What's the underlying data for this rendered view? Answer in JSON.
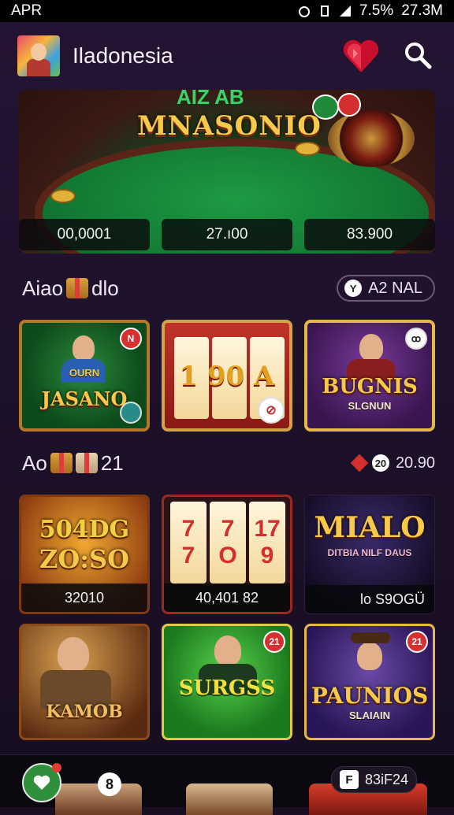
{
  "status_bar": {
    "carrier": "APR",
    "battery": "7.5%",
    "time": "27.3M"
  },
  "header": {
    "app_title": "Iladonesia"
  },
  "hero": {
    "title_top": "AIZ AB",
    "title_main": "MNASONIO",
    "stats": [
      "00,0001",
      "27.ı00",
      "83.900"
    ]
  },
  "section1": {
    "title_left": "Aiao",
    "title_right": "dlo",
    "pill_icon": "Y",
    "pill_label": "A2 NAL"
  },
  "games_row1": [
    {
      "title": "JASANO",
      "top": "OURN",
      "badge": "N"
    },
    {
      "title": "1 90 A",
      "badge": "⊘"
    },
    {
      "title": "BUGNIS",
      "sub": "SLGNUN",
      "badge": "ꝏ"
    }
  ],
  "section2": {
    "title_left": "Ao",
    "title_right": "21",
    "right_icon": "20",
    "right_label": "20.90"
  },
  "games_row2": [
    {
      "title_top": "504DG",
      "title_bottom": "ZO:SO",
      "footer": "32010"
    },
    {
      "reels": [
        "7",
        "7",
        "17"
      ],
      "reels_bottom": [
        "7",
        "O",
        "9"
      ],
      "footer": "40,401 82"
    },
    {
      "title": "MIALO",
      "sub": "DITBIA NILF DAUS",
      "footer": "lo S9OGÜ"
    }
  ],
  "games_row3": [
    {
      "title": "KAMOB"
    },
    {
      "title": "SURGSS",
      "badge": "21"
    },
    {
      "title": "PAUNIOS",
      "sub": "SLAIAIN",
      "badge": "21"
    }
  ],
  "bottom_bar": {
    "circle_label": "8",
    "pill_icon": "F",
    "pill_label": "83iF24"
  },
  "colors": {
    "accent_gold": "#f6c94a",
    "felt_green": "#137a33",
    "bg": "#1d1129"
  },
  "icons": [
    "heart-gems-icon",
    "search-icon",
    "gift-icon",
    "chip-icon",
    "menu-icon"
  ]
}
